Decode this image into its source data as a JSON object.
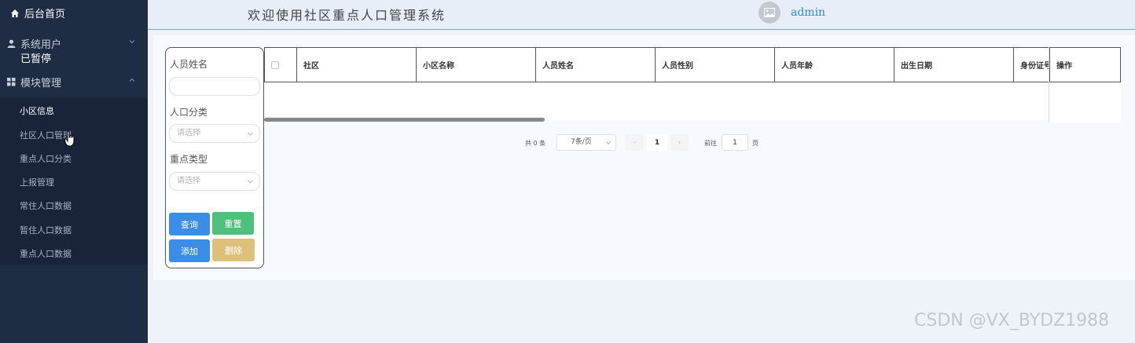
{
  "sidebar": {
    "home": "后台首页",
    "user_group": "系统用户",
    "user_sub_label": "已暂停",
    "module_group": "模块管理",
    "items": [
      {
        "label": "小区信息",
        "active": true
      },
      {
        "label": "社区人口管理",
        "active": false
      },
      {
        "label": "重点人口分类",
        "active": false
      },
      {
        "label": "上报管理",
        "active": false
      },
      {
        "label": "常住人口数据",
        "active": false
      },
      {
        "label": "暂住人口数据",
        "active": false
      },
      {
        "label": "重点人口数据",
        "active": false
      }
    ]
  },
  "header": {
    "title": "欢迎使用社区重点人口管理系统",
    "username": "admin"
  },
  "search": {
    "name_label": "人员姓名",
    "name_value": "",
    "category_label": "人口分类",
    "category_placeholder": "请选择",
    "key_type_label": "重点类型",
    "key_type_placeholder": "请选择",
    "query": "查询",
    "reset": "重置",
    "add": "添加",
    "delete": "删除"
  },
  "table": {
    "columns": [
      "社区",
      "小区名称",
      "人员姓名",
      "人员性别",
      "人员年龄",
      "出生日期",
      "身份证号"
    ],
    "operation": "操作",
    "rows": []
  },
  "pagination": {
    "total": "共 0 条",
    "page_size": "7条/页",
    "prev": "‹",
    "current_page": "1",
    "next": "›",
    "goto_label": "前往",
    "goto_value": "1",
    "page_suffix": "页"
  },
  "watermark": "CSDN @VX_BYDZ1988",
  "colors": {
    "sidebar_bg": "#1f2d44",
    "primary": "#3c8de8",
    "success": "#4fbf7c",
    "warning": "#dfc07a",
    "username": "#2f86d6"
  }
}
